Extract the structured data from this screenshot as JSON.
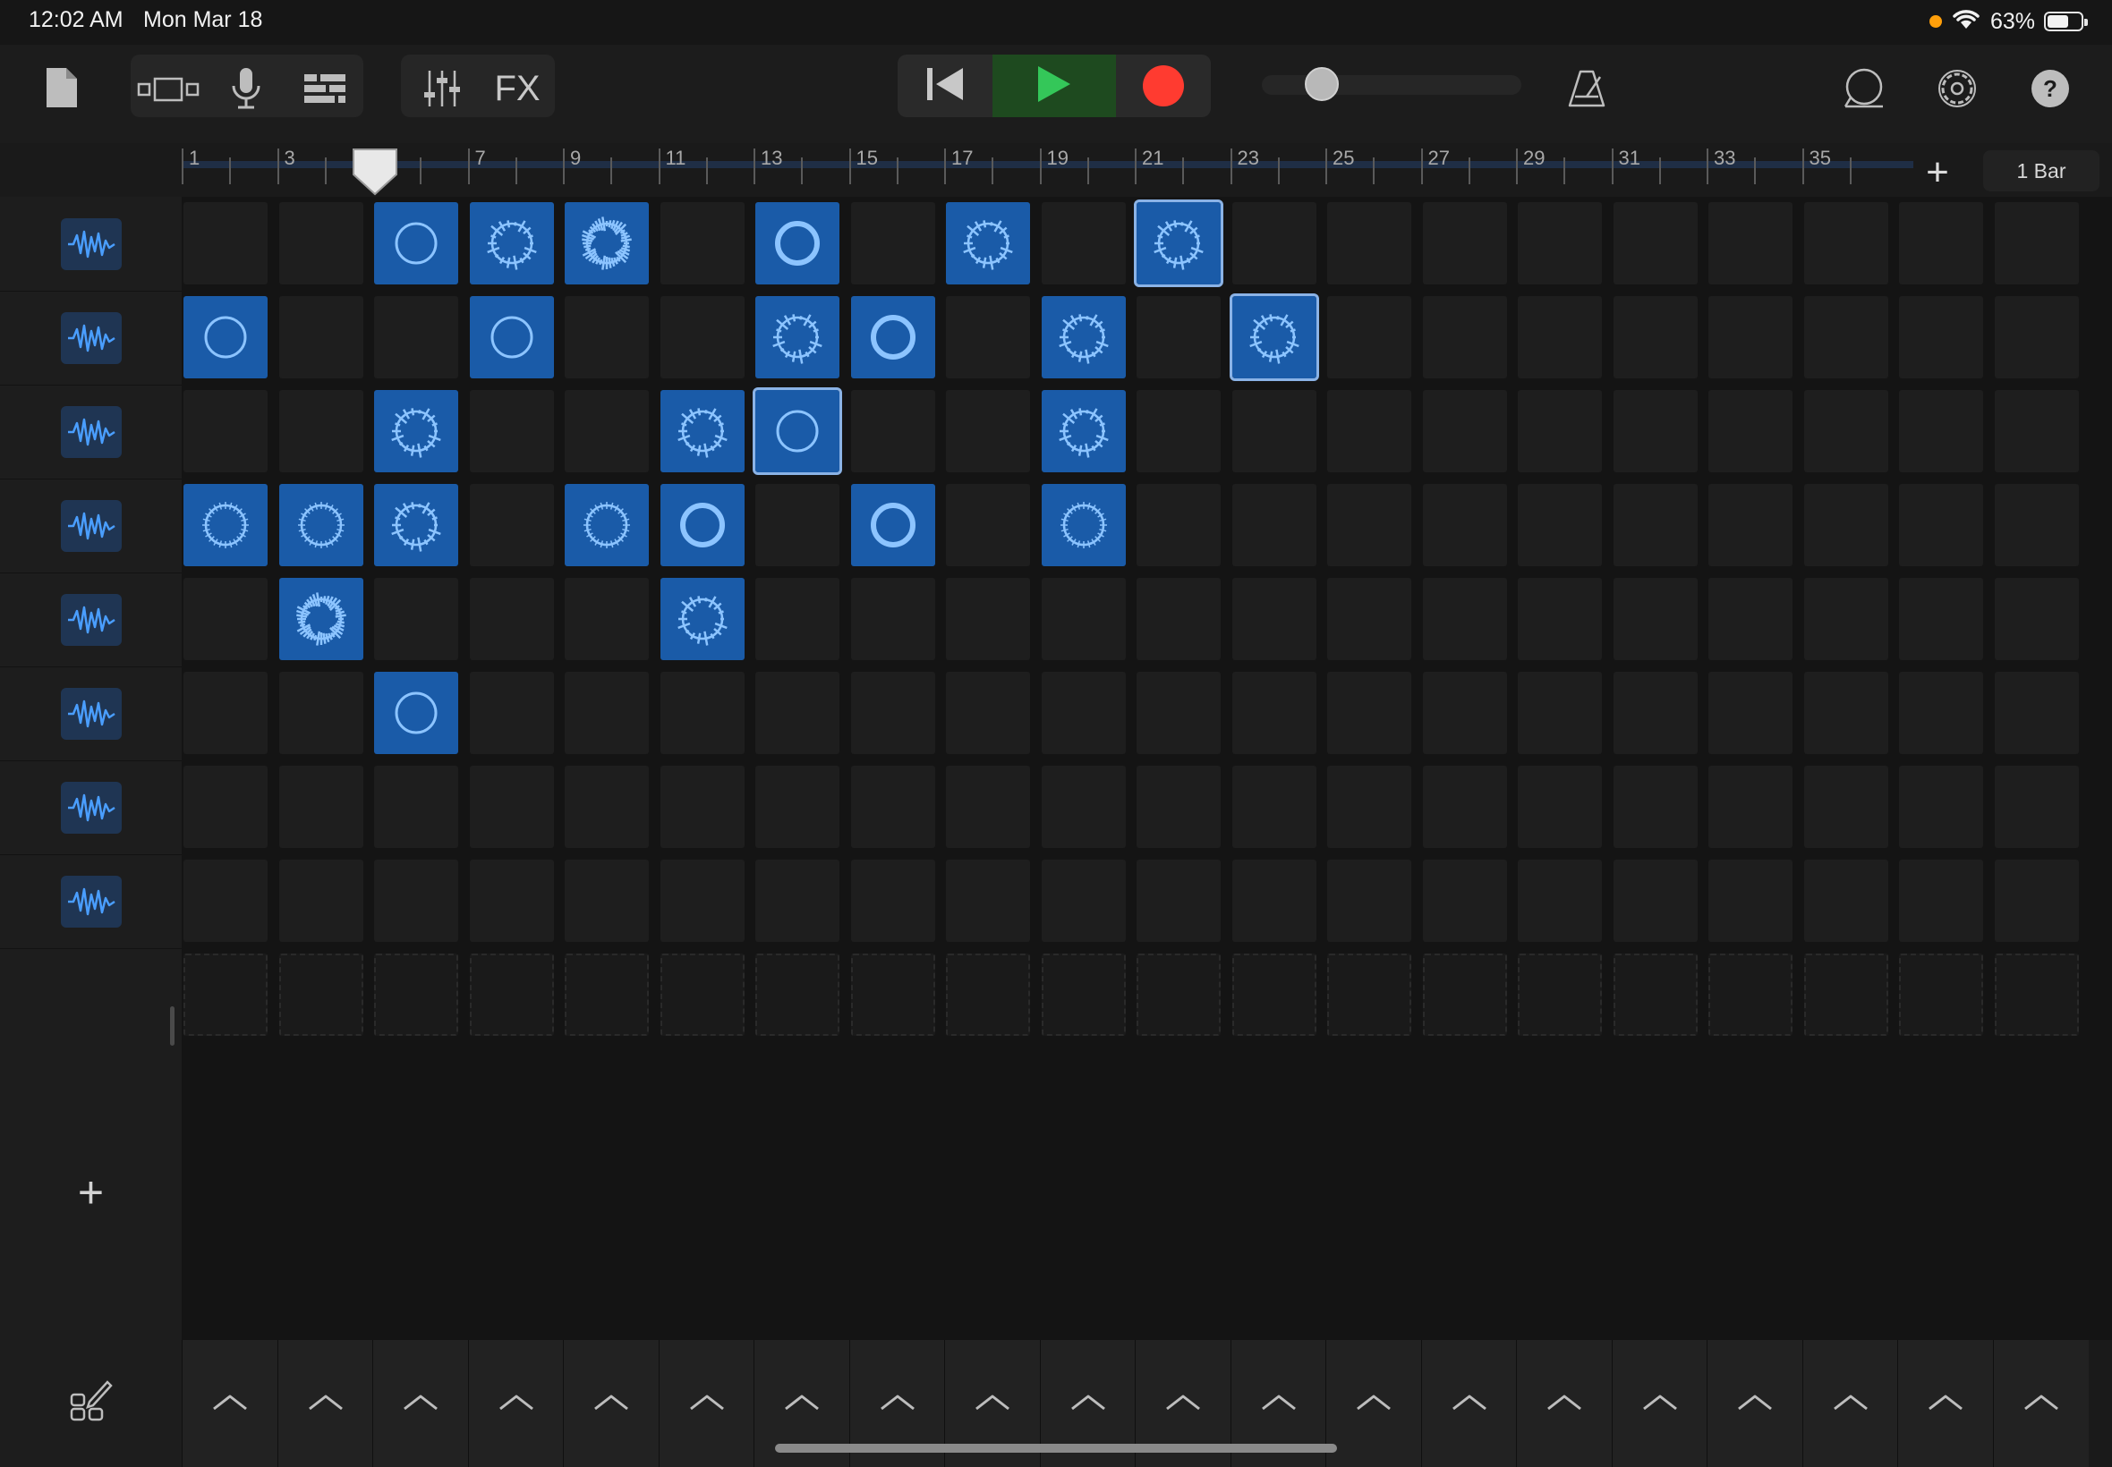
{
  "status_bar": {
    "time": "12:02 AM",
    "date": "Mon Mar 18",
    "battery": "63%",
    "battery_level": 0.63,
    "privacy_dot_color": "#ff9f0a"
  },
  "toolbar": {
    "icons": [
      "document-icon",
      "view-toggle-icon",
      "microphone-icon",
      "tracks-view-icon",
      "mixer-icon"
    ],
    "fx_label": "FX",
    "transport": [
      "rewind-icon",
      "play-icon",
      "record-icon"
    ],
    "master_volume": 0.2,
    "right_icons": [
      "metronome-icon",
      "loop-browser-icon",
      "settings-gear-icon",
      "help-icon"
    ],
    "colors": {
      "play": "#34c759",
      "record": "#ff3b30",
      "accent": "#4a9eff"
    }
  },
  "ruler": {
    "bar_numbers": [
      "1",
      "3",
      "5",
      "7",
      "9",
      "11",
      "13",
      "15",
      "17",
      "19",
      "21",
      "23",
      "25",
      "27",
      "29",
      "31",
      "33",
      "35"
    ],
    "playhead_bar": "5",
    "add_label": "+",
    "length_label": "1 Bar"
  },
  "tracks": [
    {
      "icon": "waveform-icon"
    },
    {
      "icon": "waveform-icon"
    },
    {
      "icon": "waveform-icon"
    },
    {
      "icon": "waveform-icon"
    },
    {
      "icon": "waveform-icon"
    },
    {
      "icon": "waveform-icon"
    },
    {
      "icon": "waveform-icon"
    },
    {
      "icon": "waveform-icon"
    }
  ],
  "add_track_label": "+",
  "grid": {
    "columns": 20,
    "rows": 8,
    "cells": [
      {
        "row": 0,
        "col": 2,
        "style": "ring-thin"
      },
      {
        "row": 0,
        "col": 3,
        "style": "ring-spiky"
      },
      {
        "row": 0,
        "col": 4,
        "style": "ring-dense"
      },
      {
        "row": 0,
        "col": 6,
        "style": "ring-thick"
      },
      {
        "row": 0,
        "col": 8,
        "style": "ring-spiky"
      },
      {
        "row": 0,
        "col": 10,
        "style": "ring-spiky",
        "selected": true
      },
      {
        "row": 1,
        "col": 0,
        "style": "ring-thin"
      },
      {
        "row": 1,
        "col": 3,
        "style": "ring-thin"
      },
      {
        "row": 1,
        "col": 6,
        "style": "ring-spiky"
      },
      {
        "row": 1,
        "col": 7,
        "style": "ring-thick"
      },
      {
        "row": 1,
        "col": 9,
        "style": "ring-spiky"
      },
      {
        "row": 1,
        "col": 11,
        "style": "ring-spiky",
        "selected": true
      },
      {
        "row": 2,
        "col": 2,
        "style": "ring-spiky"
      },
      {
        "row": 2,
        "col": 5,
        "style": "ring-spiky"
      },
      {
        "row": 2,
        "col": 6,
        "style": "ring-thin",
        "selected": true
      },
      {
        "row": 2,
        "col": 9,
        "style": "ring-spiky"
      },
      {
        "row": 3,
        "col": 0,
        "style": "ring-lines"
      },
      {
        "row": 3,
        "col": 1,
        "style": "ring-lines"
      },
      {
        "row": 3,
        "col": 2,
        "style": "ring-spiky"
      },
      {
        "row": 3,
        "col": 4,
        "style": "ring-lines"
      },
      {
        "row": 3,
        "col": 5,
        "style": "ring-thick"
      },
      {
        "row": 3,
        "col": 7,
        "style": "ring-thick"
      },
      {
        "row": 3,
        "col": 9,
        "style": "ring-lines"
      },
      {
        "row": 4,
        "col": 1,
        "style": "ring-dense"
      },
      {
        "row": 4,
        "col": 5,
        "style": "ring-spiky"
      },
      {
        "row": 5,
        "col": 2,
        "style": "ring-thin"
      }
    ]
  },
  "bottom": {
    "edit_icon": "edit-cells-icon",
    "trigger_icon": "chevron-up-icon",
    "trigger_count": 20
  }
}
